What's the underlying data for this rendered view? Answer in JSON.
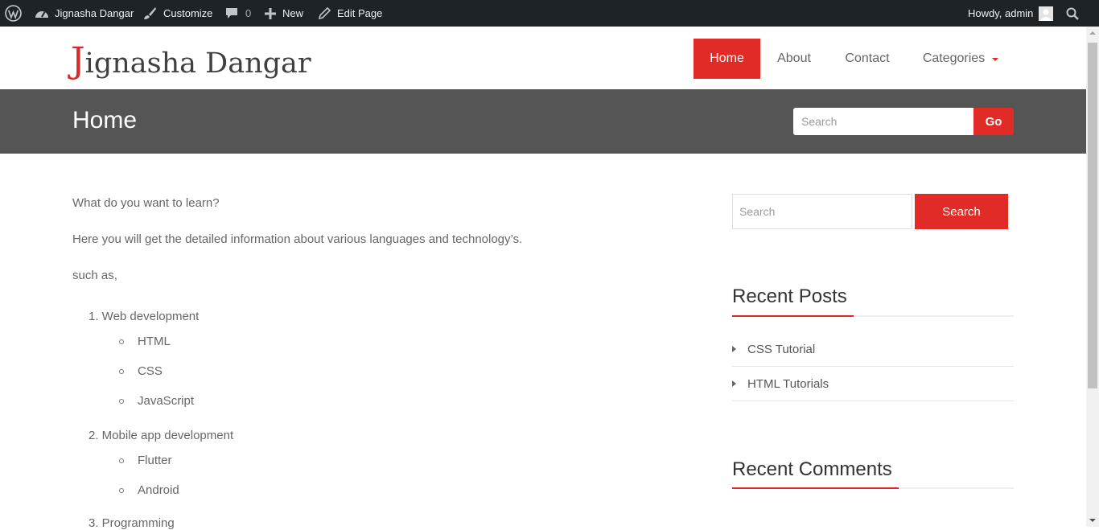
{
  "adminbar": {
    "site_name": "Jignasha Dangar",
    "customize": "Customize",
    "comments_count": "0",
    "new": "New",
    "edit_page": "Edit Page",
    "howdy": "Howdy, admin"
  },
  "header": {
    "logo_first": "J",
    "logo_rest": "ignasha Dangar",
    "nav": [
      {
        "label": "Home",
        "active": true
      },
      {
        "label": "About"
      },
      {
        "label": "Contact"
      },
      {
        "label": "Categories"
      }
    ]
  },
  "title_band": {
    "title": "Home",
    "search_placeholder": "Search",
    "go_label": "Go"
  },
  "content": {
    "para1": "What do you want to learn?",
    "para2": "Here you will get the detailed information about various languages and technology’s.",
    "para3": "such as,",
    "list": [
      {
        "label": "1. Web development",
        "children": [
          "HTML",
          "CSS",
          "JavaScript"
        ]
      },
      {
        "label": "2. Mobile app development",
        "children": [
          "Flutter",
          "Android"
        ]
      },
      {
        "label": "3. Programming",
        "children": []
      }
    ]
  },
  "sidebar": {
    "search_placeholder": "Search",
    "search_button": "Search",
    "recent_posts_title": "Recent Posts",
    "recent_posts": [
      "CSS Tutorial",
      "HTML Tutorials"
    ],
    "recent_comments_title": "Recent Comments"
  },
  "colors": {
    "accent": "#e02b27",
    "adminbar": "#1d2327",
    "title_band": "#555555"
  }
}
